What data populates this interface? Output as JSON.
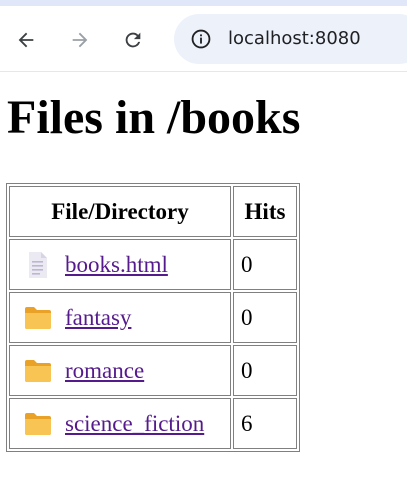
{
  "browser": {
    "url": "localhost:8080"
  },
  "page": {
    "title": "Files in /books",
    "table": {
      "headers": {
        "name": "File/Directory",
        "hits": "Hits"
      },
      "rows": [
        {
          "name": "books.html",
          "type": "file",
          "icon": "document-icon",
          "hits": "0"
        },
        {
          "name": "fantasy",
          "type": "directory",
          "icon": "folder-icon",
          "hits": "0"
        },
        {
          "name": "romance",
          "type": "directory",
          "icon": "folder-icon",
          "hits": "0"
        },
        {
          "name": "science_fiction",
          "type": "directory",
          "icon": "folder-icon",
          "hits": "6"
        }
      ]
    }
  },
  "colors": {
    "link_visited": "#551a8b",
    "folder": "#f6b73c",
    "border": "#808080",
    "address_bar": "#edf1fa"
  }
}
